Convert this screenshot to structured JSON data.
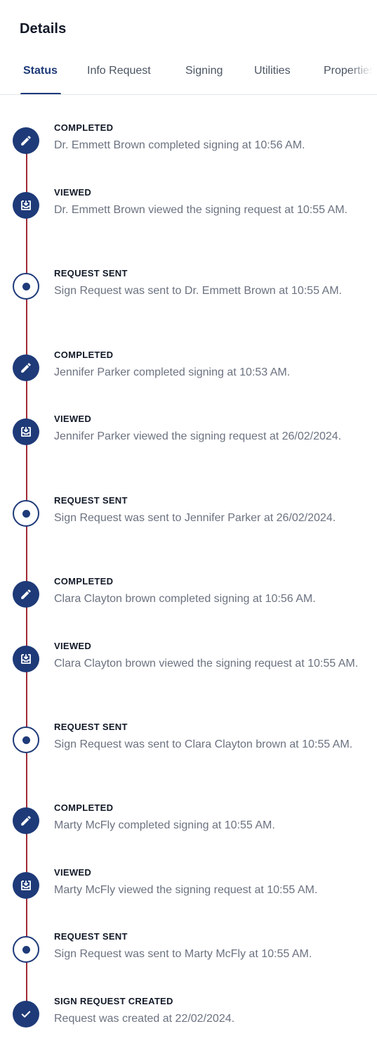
{
  "panel": {
    "title": "Details"
  },
  "tabs": [
    {
      "label": "Status",
      "active": true
    },
    {
      "label": "Info Request",
      "active": false
    },
    {
      "label": "Signing",
      "active": false
    },
    {
      "label": "Utilities",
      "active": false
    },
    {
      "label": "Properties",
      "active": false
    }
  ],
  "timeline": [
    {
      "type": "completed",
      "icon": "pencil-icon",
      "title": "COMPLETED",
      "desc": "Dr. Emmett Brown completed signing at 10:56 AM."
    },
    {
      "type": "viewed",
      "icon": "inbox-download-icon",
      "title": "VIEWED",
      "desc": "Dr. Emmett Brown viewed the signing request at 10:55 AM."
    },
    {
      "type": "request-sent",
      "icon": "dot-icon",
      "title": "REQUEST SENT",
      "desc": "Sign Request was sent to Dr. Emmett Brown at 10:55 AM."
    },
    {
      "type": "completed",
      "icon": "pencil-icon",
      "title": "COMPLETED",
      "desc": "Jennifer Parker completed signing at 10:53 AM."
    },
    {
      "type": "viewed",
      "icon": "inbox-download-icon",
      "title": "VIEWED",
      "desc": "Jennifer Parker viewed the signing request at 26/02/2024."
    },
    {
      "type": "request-sent",
      "icon": "dot-icon",
      "title": "REQUEST SENT",
      "desc": "Sign Request was sent to Jennifer Parker at 26/02/2024."
    },
    {
      "type": "completed",
      "icon": "pencil-icon",
      "title": "COMPLETED",
      "desc": "Clara Clayton brown completed signing at 10:56 AM."
    },
    {
      "type": "viewed",
      "icon": "inbox-download-icon",
      "title": "VIEWED",
      "desc": "Clara Clayton brown viewed the signing request at 10:55 AM."
    },
    {
      "type": "request-sent",
      "icon": "dot-icon",
      "title": "REQUEST SENT",
      "desc": "Sign Request was sent to Clara Clayton brown at 10:55 AM."
    },
    {
      "type": "completed",
      "icon": "pencil-icon",
      "title": "COMPLETED",
      "desc": "Marty McFly completed signing at 10:55 AM."
    },
    {
      "type": "viewed",
      "icon": "inbox-download-icon",
      "title": "VIEWED",
      "desc": "Marty McFly viewed the signing request at 10:55 AM."
    },
    {
      "type": "request-sent",
      "icon": "dot-icon",
      "title": "REQUEST SENT",
      "desc": "Sign Request was sent to Marty McFly at 10:55 AM."
    },
    {
      "type": "created",
      "icon": "check-icon",
      "title": "SIGN REQUEST CREATED",
      "desc": "Request was created at 22/02/2024."
    }
  ],
  "colors": {
    "accent": "#1e3a78",
    "timeline_line": "#9f2b35",
    "muted_text": "#6b7280"
  }
}
